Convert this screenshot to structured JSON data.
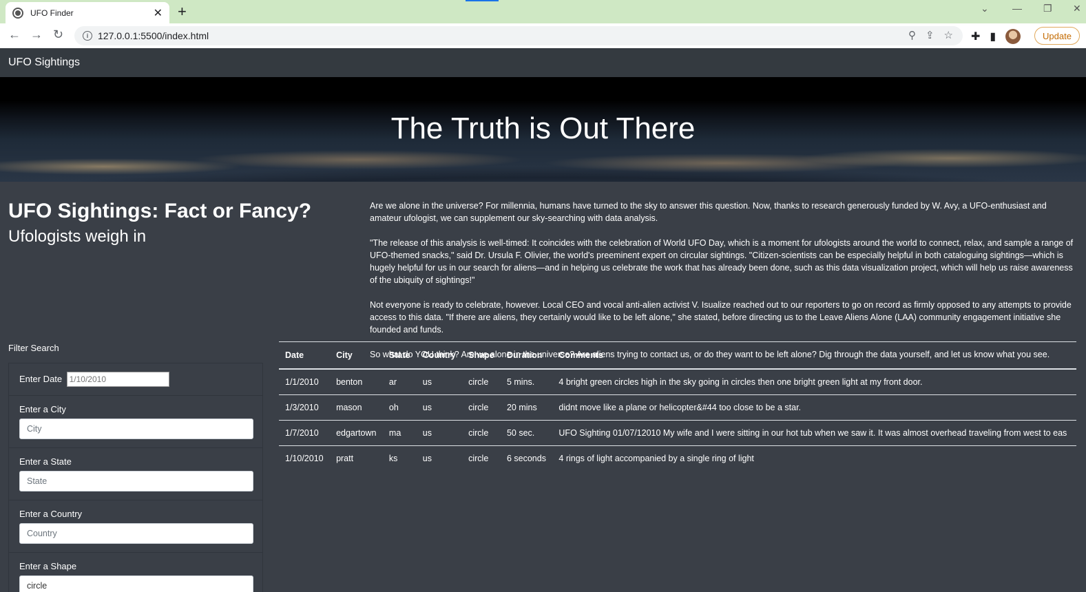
{
  "browser": {
    "tab_title": "UFO Finder",
    "url": "127.0.0.1:5500/index.html",
    "update_label": "Update"
  },
  "navbar": {
    "brand": "UFO Sightings"
  },
  "hero": {
    "title": "The Truth is Out There"
  },
  "intro": {
    "title": "UFO Sightings: Fact or Fancy?",
    "subtitle": "Ufologists weigh in"
  },
  "article": {
    "paragraphs": [
      "Are we alone in the universe? For millennia, humans have turned to the sky to answer this question. Now, thanks to research generously funded by W. Avy, a UFO-enthusiast and amateur ufologist, we can supplement our sky-searching with data analysis.",
      "\"The release of this analysis is well-timed: It coincides with the celebration of World UFO Day, which is a moment for ufologists around the world to connect, relax, and sample a range of UFO-themed snacks,\" said Dr. Ursula F. Olivier, the world's preeminent expert on circular sightings. \"Citizen-scientists can be especially helpful in both cataloguing sightings—which is hugely helpful for us in our search for aliens—and in helping us celebrate the work that has already been done, such as this data visualization project, which will help us raise awareness of the ubiquity of sightings!\"",
      "Not everyone is ready to celebrate, however. Local CEO and vocal anti-alien activist V. Isualize reached out to our reporters to go on record as firmly opposed to any attempts to provide access to this data. \"If there are aliens, they certainly would like to be left alone,\" she stated, before directing us to the Leave Aliens Alone (LAA) community engagement initiative she founded and funds.",
      "So what do YOU think? Are we alone in the universe? Are aliens trying to contact us, or do they want to be left alone? Dig through the data yourself, and let us know what you see."
    ]
  },
  "filters": {
    "title": "Filter Search",
    "date": {
      "label": "Enter Date",
      "placeholder": "1/10/2010"
    },
    "city": {
      "label": "Enter a City",
      "placeholder": "City"
    },
    "state": {
      "label": "Enter a State",
      "placeholder": "State"
    },
    "country": {
      "label": "Enter a Country",
      "placeholder": "Country"
    },
    "shape": {
      "label": "Enter a Shape",
      "value": "circle"
    }
  },
  "table": {
    "headers": [
      "Date",
      "City",
      "State",
      "Country",
      "Shape",
      "Duration",
      "Comments"
    ],
    "rows": [
      [
        "1/1/2010",
        "benton",
        "ar",
        "us",
        "circle",
        "5 mins.",
        "4 bright green circles high in the sky going in circles then one bright green light at my front door."
      ],
      [
        "1/3/2010",
        "mason",
        "oh",
        "us",
        "circle",
        "20 mins",
        "didnt move like a plane or helicopter&#44 too close to be a star."
      ],
      [
        "1/7/2010",
        "edgartown",
        "ma",
        "us",
        "circle",
        "50 sec.",
        "UFO Sighting 01/07/12010 My wife and I were sitting in our hot tub when we saw it. It was almost overhead traveling from west to eas"
      ],
      [
        "1/10/2010",
        "pratt",
        "ks",
        "us",
        "circle",
        "6 seconds",
        "4 rings of light accompanied by a single ring of light"
      ]
    ]
  }
}
